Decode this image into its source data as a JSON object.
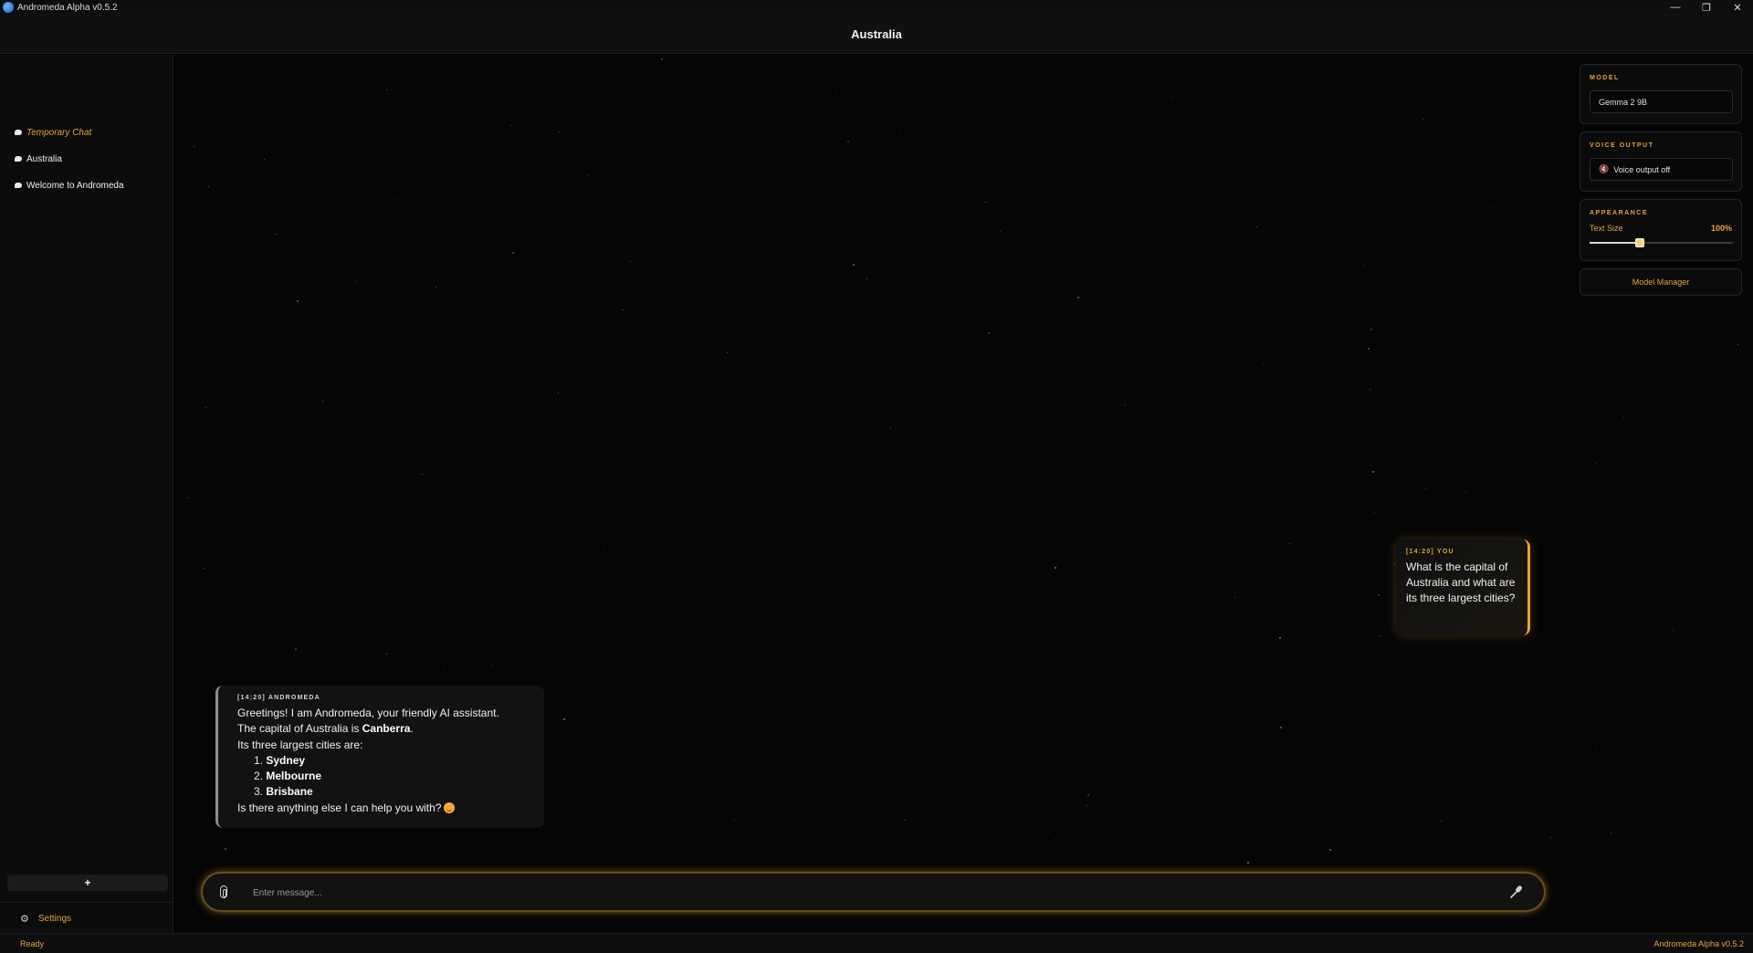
{
  "window": {
    "app_title": "Andromeda Alpha v0.5.2",
    "controls": {
      "minimize": "—",
      "restore": "❐",
      "close": "✕"
    }
  },
  "header": {
    "title": "Australia"
  },
  "sidebar": {
    "items": [
      {
        "label": "Temporary Chat",
        "icon": "chat-bubble-icon"
      },
      {
        "label": "Australia",
        "icon": "chat-bubble-icon"
      },
      {
        "label": "Welcome to Andromeda",
        "icon": "chat-bubble-icon"
      }
    ],
    "new_chat_label": "+",
    "settings_label": "Settings",
    "settings_icon": "⚙"
  },
  "panel": {
    "model": {
      "title": "MODEL",
      "value": "Gemma 2 9B"
    },
    "voice": {
      "title": "VOICE OUTPUT",
      "value": "Voice output off",
      "icon": "speaker-muted-icon"
    },
    "appearance": {
      "title": "APPEARANCE",
      "text_size_label": "Text Size",
      "text_size_value": "100%",
      "text_size_fraction": 0.35
    },
    "model_manager_label": "Model Manager"
  },
  "messages": {
    "user": {
      "meta": "[14:20] YOU",
      "text": "What is the capital of Australia and what are its three largest cities?"
    },
    "ai": {
      "meta": "[14:20] ANDROMEDA",
      "greeting": "Greetings! I am Andromeda, your friendly AI assistant.",
      "capital_prefix": "The capital of Australia is ",
      "capital": "Canberra",
      "capital_suffix": ".",
      "cities_intro": "Its three largest cities are:",
      "cities": [
        {
          "num": "1.",
          "name": "Sydney"
        },
        {
          "num": "2.",
          "name": "Melbourne"
        },
        {
          "num": "3.",
          "name": "Brisbane"
        }
      ],
      "closing": "Is there anything else I can help you with?"
    }
  },
  "input": {
    "placeholder": "Enter message..."
  },
  "status": {
    "left": "Ready",
    "right": "Andromeda Alpha v0.5.2"
  },
  "colors": {
    "accent": "#e2a53a",
    "background": "#050505",
    "sidebar": "#0c0c0c"
  }
}
